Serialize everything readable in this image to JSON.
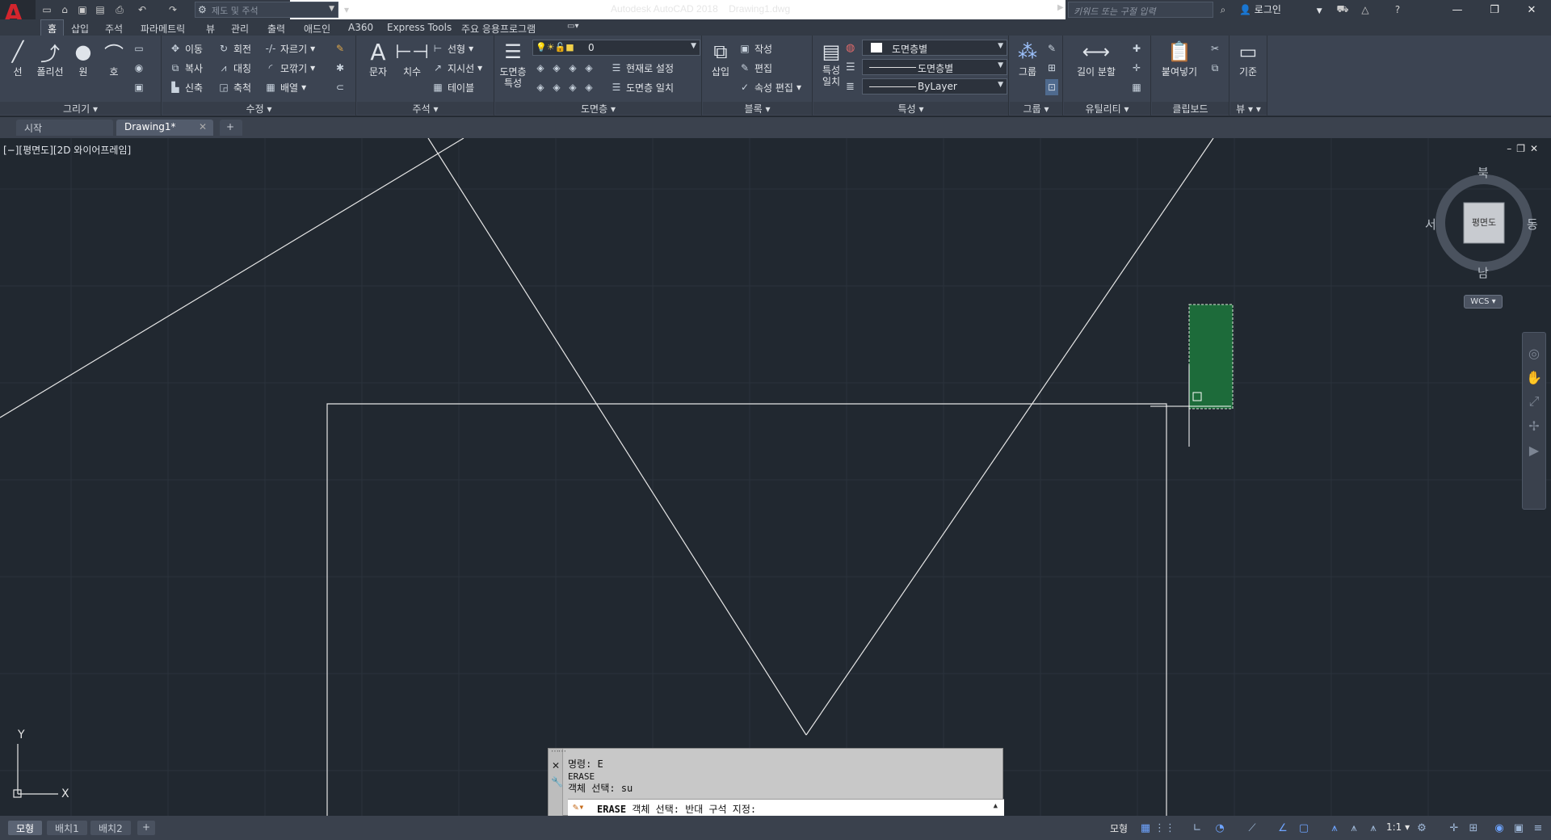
{
  "title": {
    "app": "Autodesk AutoCAD 2018",
    "file": "Drawing1.dwg"
  },
  "workspace": {
    "placeholder": "제도 및 주석"
  },
  "search": {
    "placeholder": "키워드 또는 구절 입력"
  },
  "login": {
    "label": "로그인"
  },
  "ribbon_tabs": [
    "홈",
    "삽입",
    "주석",
    "파라메트릭",
    "뷰",
    "관리",
    "출력",
    "애드인",
    "A360",
    "Express Tools",
    "주요 응용프로그램"
  ],
  "panels": {
    "draw": {
      "title": "그리기",
      "line": "선",
      "polyline": "폴리선",
      "circle": "원",
      "arc": "호"
    },
    "modify": {
      "title": "수정",
      "move": "이동",
      "rotate": "회전",
      "trim": "자르기",
      "copy": "복사",
      "mirror": "대칭",
      "fillet": "모깎기",
      "stretch": "신축",
      "scale": "축척",
      "array": "배열"
    },
    "annotation": {
      "title": "주석",
      "text": "문자",
      "dimension": "치수",
      "linear": "선형",
      "leader": "지시선",
      "table": "테이블"
    },
    "layers": {
      "title": "도면층",
      "properties": "도면층 특성",
      "current_layer": "0",
      "set_current": "현재로 설정",
      "match_layer": "도면층 일치"
    },
    "block": {
      "title": "블록",
      "insert": "삽입",
      "create": "작성",
      "edit": "편집",
      "edit_attributes": "속성 편집"
    },
    "properties": {
      "title": "특성",
      "match": "특성 일치",
      "color": "도면층별",
      "linetype": "도면층별",
      "lineweight": "ByLayer"
    },
    "groups": {
      "title": "그룹",
      "group": "그룹"
    },
    "utilities": {
      "title": "유틸리티",
      "measure": "길이 분할"
    },
    "clipboard": {
      "title": "클립보드",
      "paste": "붙여넣기"
    },
    "view": {
      "title": "뷰",
      "base": "기준"
    }
  },
  "file_tabs": {
    "start": "시작",
    "drawing": "Drawing1*"
  },
  "viewport": {
    "label": "[−][평면도][2D 와이어프레임]",
    "viewcube": {
      "north": "북",
      "south": "남",
      "east": "동",
      "west": "서",
      "face": "평면도",
      "wcs": "WCS"
    },
    "ucs": {
      "x": "X",
      "y": "Y"
    }
  },
  "command": {
    "history": [
      "명령: E",
      "ERASE",
      "객체 선택: su"
    ],
    "prompt_cmd": "ERASE",
    "prompt_text": "객체 선택: 반대 구석 지정:"
  },
  "status": {
    "model_tab": "모형",
    "layout1": "배치1",
    "layout2": "배치2",
    "model_space": "모형",
    "scale": "1:1"
  }
}
